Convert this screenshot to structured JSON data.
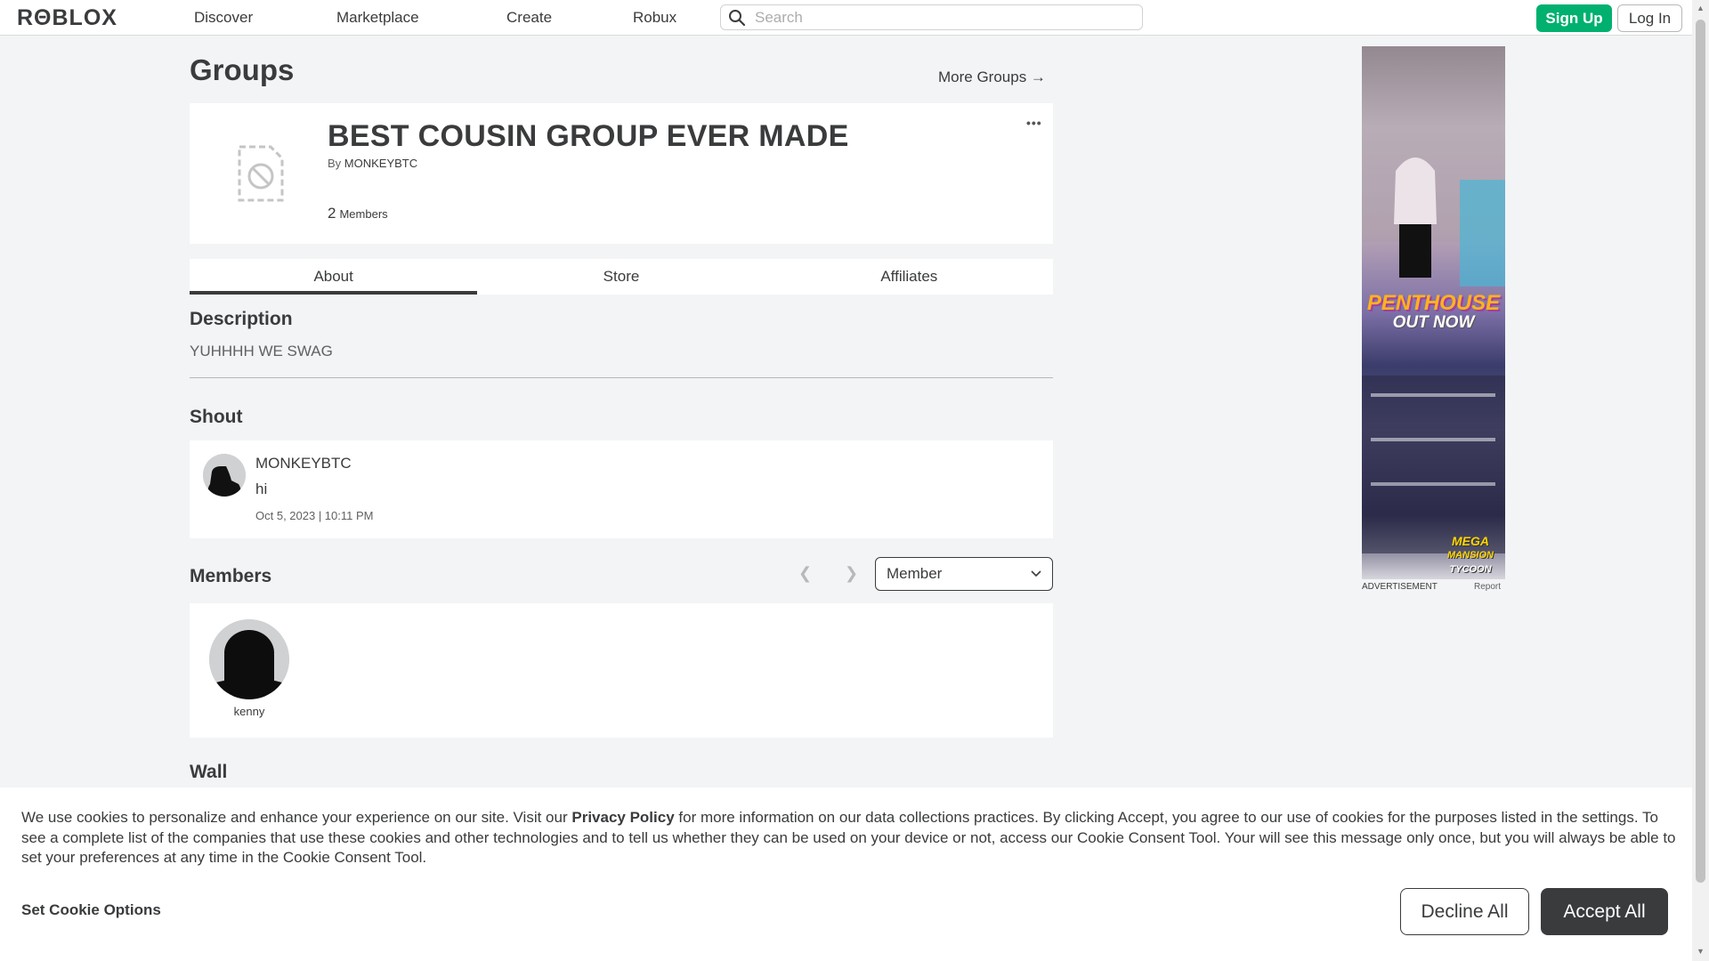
{
  "nav": {
    "logo_text": "RΘBLOX",
    "links": [
      "Discover",
      "Marketplace",
      "Create",
      "Robux"
    ],
    "search_placeholder": "Search",
    "signup_label": "Sign Up",
    "login_label": "Log In"
  },
  "page": {
    "title": "Groups",
    "more_groups": "More Groups →"
  },
  "group": {
    "name": "BEST COUSIN GROUP EVER MADE",
    "by_prefix": "By",
    "owner": "MONKEYBTC",
    "member_count": "2",
    "member_label": "Members",
    "menu": "•••"
  },
  "tabs": [
    "About",
    "Store",
    "Affiliates"
  ],
  "description": {
    "title": "Description",
    "text": "YUHHHH WE SWAG"
  },
  "shout": {
    "title": "Shout",
    "user": "MONKEYBTC",
    "body": "hi",
    "time": "Oct 5, 2023 | 10:11 PM"
  },
  "members": {
    "title": "Members",
    "role_selected": "Member",
    "list": [
      {
        "name": "kenny"
      }
    ]
  },
  "wall": {
    "title": "Wall"
  },
  "ad": {
    "text1": "PENTHOUSE",
    "text2": "OUT NOW",
    "text3a": "MEGA",
    "text3b": "MANSION",
    "text3c": "TYCOON",
    "label": "ADVERTISEMENT",
    "report": "Report"
  },
  "cookie": {
    "text_before": "We use cookies to personalize and enhance your experience on our site. Visit our ",
    "link": "Privacy Policy",
    "text_after": " for more information on our data collections practices. By clicking Accept, you agree to our use of cookies for the purposes listed in the settings. To see a complete list of the companies that use these cookies and other technologies and to tell us whether they can be used on your device or not, access our Cookie Consent Tool. Your will see this message only once, but you will always be able to set your preferences at any time in the Cookie Consent Tool.",
    "options_label": "Set Cookie Options",
    "decline_label": "Decline All",
    "accept_label": "Accept All"
  },
  "colors": {
    "accent_green": "#00b06f",
    "text_dark": "#393b3d",
    "page_bg": "#f2f4f5"
  }
}
